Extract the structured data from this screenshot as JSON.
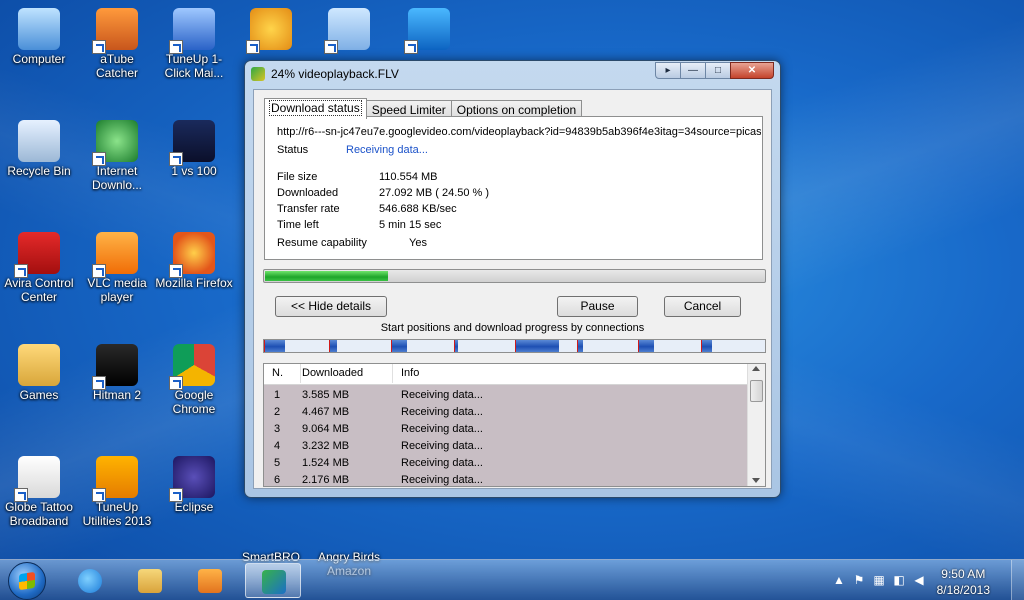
{
  "desktop": {
    "icons": [
      {
        "label": "Computer"
      },
      {
        "label": "aTube Catcher"
      },
      {
        "label": "TuneUp 1-Click Mai..."
      },
      {
        "label": ""
      },
      {
        "label": ""
      },
      {
        "label": ""
      },
      {
        "label": "Recycle Bin"
      },
      {
        "label": "Internet Downlo..."
      },
      {
        "label": "1 vs 100"
      },
      {
        "label": "Avira Control Center"
      },
      {
        "label": "VLC media player"
      },
      {
        "label": "Mozilla Firefox"
      },
      {
        "label": "Games"
      },
      {
        "label": "Hitman 2"
      },
      {
        "label": "Google Chrome"
      },
      {
        "label": "Globe Tattoo Broadband"
      },
      {
        "label": "TuneUp Utilities 2013"
      },
      {
        "label": "Eclipse"
      },
      {
        "label": "SmartBRO"
      },
      {
        "label": "Angry Birds Amazon"
      }
    ]
  },
  "window": {
    "title": "24% videoplayback.FLV",
    "tabs": [
      {
        "label": "Download status"
      },
      {
        "label": "Speed Limiter"
      },
      {
        "label": "Options on completion"
      }
    ],
    "url": "http://r6---sn-jc47eu7e.googlevideo.com/videoplayback?id=94839b5ab396f4e3itag=34source=picas",
    "status_label": "Status",
    "status_value": "Receiving data...",
    "details": [
      {
        "key": "File size",
        "value": "110.554  MB"
      },
      {
        "key": "Downloaded",
        "value": "27.092  MB  ( 24.50 % )"
      },
      {
        "key": "Transfer rate",
        "value": "546.688  KB/sec"
      },
      {
        "key": "Time left",
        "value": "5 min 15 sec"
      },
      {
        "key": "Resume capability",
        "value": "Yes"
      }
    ],
    "progress_fraction": 0.245,
    "buttons": {
      "hide_details": "<< Hide details",
      "pause": "Pause",
      "cancel": "Cancel"
    },
    "connections_title": "Start positions and download progress by connections",
    "connection_segments": [
      {
        "start": 0.0,
        "progress": 0.04
      },
      {
        "start": 0.13,
        "progress": 0.014
      },
      {
        "start": 0.254,
        "progress": 0.03
      },
      {
        "start": 0.38,
        "progress": 0.006
      },
      {
        "start": 0.5,
        "progress": 0.087
      },
      {
        "start": 0.624,
        "progress": 0.01
      },
      {
        "start": 0.746,
        "progress": 0.03
      },
      {
        "start": 0.872,
        "progress": 0.02
      }
    ],
    "list": {
      "columns": [
        "N.",
        "Downloaded",
        "Info"
      ],
      "rows": [
        {
          "n": "1",
          "downloaded": "3.585  MB",
          "info": "Receiving data..."
        },
        {
          "n": "2",
          "downloaded": "4.467  MB",
          "info": "Receiving data..."
        },
        {
          "n": "3",
          "downloaded": "9.064  MB",
          "info": "Receiving data..."
        },
        {
          "n": "4",
          "downloaded": "3.232  MB",
          "info": "Receiving data..."
        },
        {
          "n": "5",
          "downloaded": "1.524  MB",
          "info": "Receiving data..."
        },
        {
          "n": "6",
          "downloaded": "2.176  MB",
          "info": "Receiving data..."
        }
      ]
    }
  },
  "taskbar": {
    "time": "9:50 AM",
    "date": "8/18/2013"
  }
}
